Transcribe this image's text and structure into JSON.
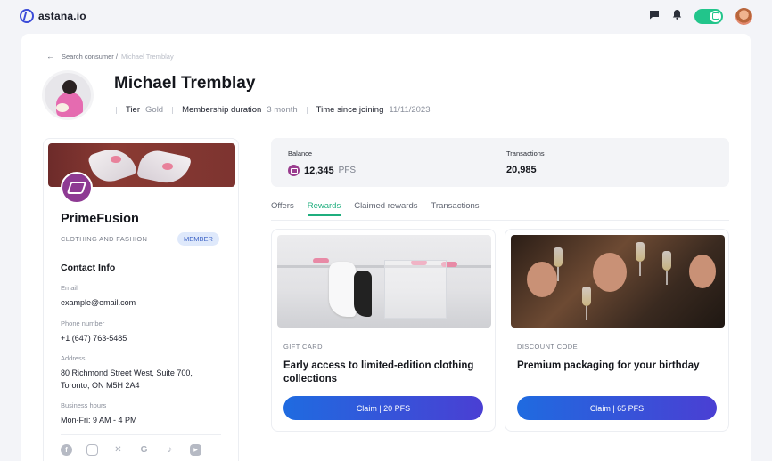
{
  "topbar": {
    "logo_text": "astana.io",
    "icons": [
      "message-icon",
      "bell-icon",
      "toggle-icon",
      "avatar"
    ]
  },
  "breadcrumb": {
    "parent": "Search consumer /",
    "current": "Michael Tremblay"
  },
  "profile": {
    "name": "Michael Tremblay",
    "tier_label": "Tier",
    "tier_value": "Gold",
    "duration_label": "Membership duration",
    "duration_value": "3 month",
    "joined_label": "Time since joining",
    "joined_value": "11/11/2023"
  },
  "brand": {
    "name": "PrimeFusion",
    "category": "CLOTHING AND FASHION",
    "badge": "MEMBER",
    "contact_title": "Contact Info",
    "email_label": "Email",
    "email_value": "example@email.com",
    "phone_label": "Phone number",
    "phone_value": "+1 (647) 763-5485",
    "address_label": "Address",
    "address_line1": "80 Richmond Street West, Suite 700,",
    "address_line2": "Toronto, ON M5H 2A4",
    "hours_label": "Business hours",
    "hours_value": "Mon-Fri: 9 AM - 4 PM",
    "socials": [
      "facebook-icon",
      "instagram-icon",
      "x-icon",
      "google-icon",
      "tiktok-icon",
      "youtube-icon"
    ]
  },
  "stats": {
    "balance_label": "Balance",
    "balance_value": "12,345",
    "balance_unit": "PFS",
    "transactions_label": "Transactions",
    "transactions_value": "20,985"
  },
  "tabs": [
    "Offers",
    "Rewards",
    "Claimed rewards",
    "Transactions"
  ],
  "active_tab": "Rewards",
  "rewards": [
    {
      "type": "GIFT CARD",
      "title": "Early access to limited-edition clothing collections",
      "button": "Claim | 20 PFS"
    },
    {
      "type": "DISCOUNT CODE",
      "title": "Premium packaging for your birthday",
      "button": "Claim | 65 PFS"
    }
  ],
  "colors": {
    "accent_green": "#1fae7e",
    "brand_purple": "#8e3a93",
    "button_blue": "#1f6be0",
    "member_badge": "#dfe9fb"
  }
}
